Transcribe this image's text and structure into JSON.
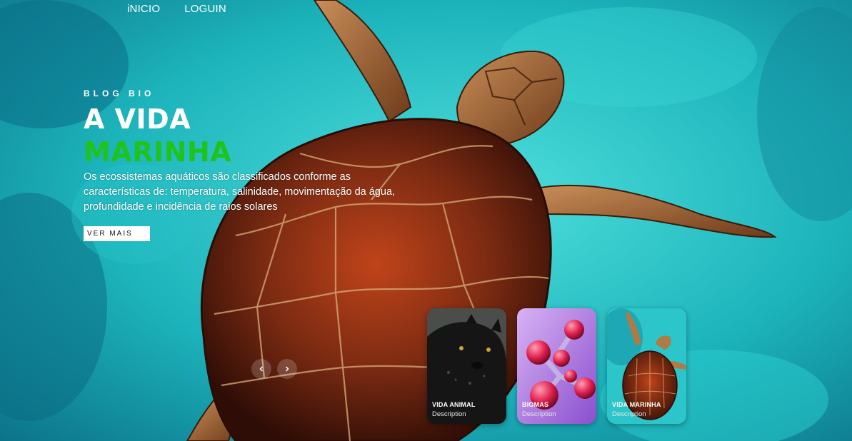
{
  "nav": {
    "items": [
      "iNICIO",
      "LOGUIN"
    ]
  },
  "hero": {
    "eyebrow": "BLOG BIO",
    "title_line1": "A VIDA",
    "title_line2": "MARINHA",
    "description": "Os ecossistemas aquáticos são classificados conforme as características de: temperatura, salinidade, movimentação da água, profundidade e incidência de raios solares",
    "button_label": "VER MAIS"
  },
  "slider": {
    "prev_icon": "chevron-left-icon",
    "next_icon": "chevron-right-icon"
  },
  "cards": [
    {
      "title": "VIDA ANIMAL",
      "description": "Description",
      "image": "black-panther"
    },
    {
      "title": "BIOMAS",
      "description": "Description",
      "image": "molecules"
    },
    {
      "title": "VIDA MARINHA",
      "description": "Description",
      "image": "sea-turtle"
    }
  ],
  "colors": {
    "accent_green": "#1ec41a",
    "ocean": "#1fb9c2",
    "shell": "#7a2a12"
  }
}
